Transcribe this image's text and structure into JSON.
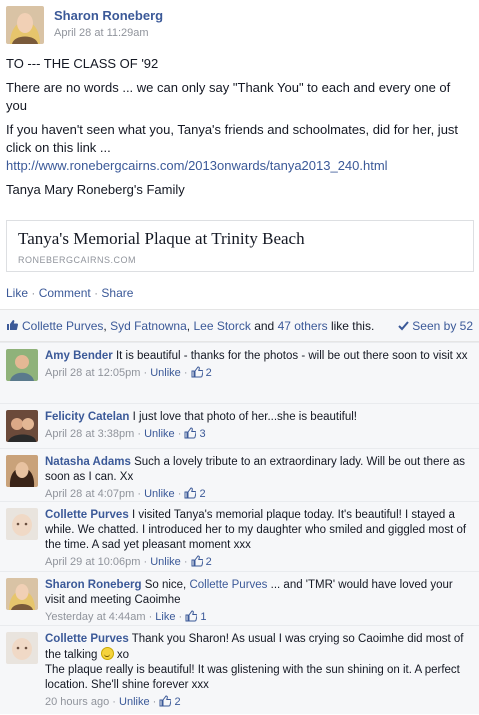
{
  "post": {
    "author": "Sharon Roneberg",
    "timestamp": "April 28 at 11:29am",
    "lines": [
      "TO --- THE CLASS OF '92",
      "There are no words ... we can only say \"Thank You\" to each and every one of you",
      "If you haven't seen what you, Tanya's friends and schoolmates, did for her, just click on this link ...",
      "http://www.ronebergcairns.com/2013onwards/tanya2013_240.html",
      "Tanya Mary Roneberg's Family"
    ],
    "share_card": {
      "title": "Tanya's Memorial Plaque at Trinity Beach",
      "domain": "RONEBERGCAIRNS.COM"
    },
    "actions": {
      "like": "Like",
      "comment": "Comment",
      "share": "Share",
      "separator": "·"
    },
    "likes": {
      "names": [
        "Collette Purves",
        "Syd Fatnowna",
        "Lee Storck"
      ],
      "comma": ",",
      "and": "and",
      "others": "47 others",
      "suffix": "like this.",
      "seen": "Seen by 52"
    }
  },
  "comments": [
    {
      "name": "Amy Bender",
      "text": "It is beautiful - thanks for the photos - will be out there soon to visit xx",
      "time": "April 28 at 12:05pm",
      "action": "Unlike",
      "likes": "2"
    },
    {
      "name": "Felicity Catelan",
      "text": "I just love that photo of her...she is beautiful!",
      "time": "April 28 at 3:38pm",
      "action": "Unlike",
      "likes": "3"
    },
    {
      "name": "Natasha Adams",
      "text": "Such a lovely tribute to an extraordinary lady. Will be out there as soon as I can. Xx",
      "time": "April 28 at 4:07pm",
      "action": "Unlike",
      "likes": "2"
    },
    {
      "name": "Collette Purves",
      "text": "I visited Tanya's memorial plaque today. It's beautiful! I stayed a while. We chatted. I introduced her to my daughter who smiled and giggled most of the time. A sad yet pleasant moment xxx",
      "time": "April 29 at 10:06pm",
      "action": "Unlike",
      "likes": "2"
    },
    {
      "name": "Sharon Roneberg",
      "text_a": "So nice,",
      "mention": "Collette Purves",
      "text_b": "... and 'TMR' would have loved your visit and meeting Caoimhe",
      "time": "Yesterday at 4:44am",
      "action": "Like",
      "likes": "1"
    },
    {
      "name": "Collette Purves",
      "text_a": "Thank you Sharon! As usual I was crying so Caoimhe did most of the talking",
      "text_b": "xo",
      "text_c": "The plaque really is beautiful! It was glistening with the sun shining on it. A perfect location. She'll shine forever xxx",
      "time": "20 hours ago",
      "action": "Unlike",
      "likes": "2"
    }
  ],
  "meta_separator": "·",
  "colors": {
    "link": "#3b5998",
    "meta": "#90949c",
    "panel": "#f6f7f9"
  }
}
